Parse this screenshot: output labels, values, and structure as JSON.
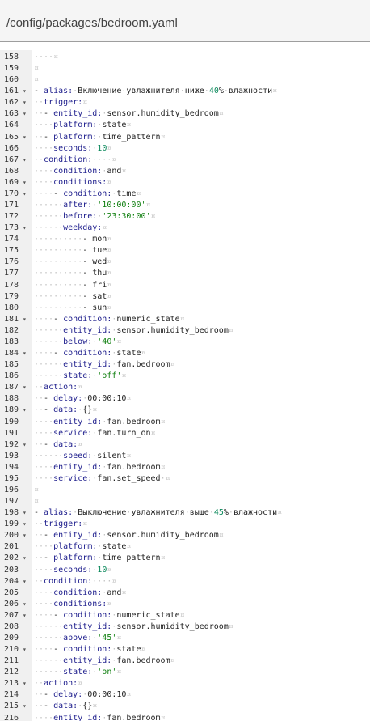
{
  "header": {
    "path": "/config/packages/bedroom.yaml"
  },
  "lines": [
    {
      "n": "158",
      "fold": "",
      "segs": [
        [
          "ws",
          "····¤"
        ]
      ]
    },
    {
      "n": "159",
      "fold": "",
      "segs": [
        [
          "ws",
          "¤"
        ]
      ]
    },
    {
      "n": "160",
      "fold": "",
      "segs": [
        [
          "ws",
          "¤"
        ]
      ]
    },
    {
      "n": "161",
      "fold": "▾",
      "segs": [
        [
          "p",
          "- "
        ],
        [
          "k",
          "alias:"
        ],
        [
          "ws",
          "·"
        ],
        [
          "p",
          "Включение"
        ],
        [
          "ws",
          "·"
        ],
        [
          "p",
          "увлажнителя"
        ],
        [
          "ws",
          "·"
        ],
        [
          "p",
          "ниже"
        ],
        [
          "ws",
          "·"
        ],
        [
          "n",
          "40"
        ],
        [
          "p",
          "%"
        ],
        [
          "ws",
          "·"
        ],
        [
          "p",
          "влажности"
        ],
        [
          "ws",
          "¤"
        ]
      ]
    },
    {
      "n": "162",
      "fold": "▾",
      "segs": [
        [
          "ws",
          "··"
        ],
        [
          "k",
          "trigger:"
        ],
        [
          "ws",
          "¤"
        ]
      ]
    },
    {
      "n": "163",
      "fold": "▾",
      "segs": [
        [
          "ws",
          "··"
        ],
        [
          "p",
          "- "
        ],
        [
          "k",
          "entity_id:"
        ],
        [
          "ws",
          "·"
        ],
        [
          "p",
          "sensor.humidity_bedroom"
        ],
        [
          "ws",
          "¤"
        ]
      ]
    },
    {
      "n": "164",
      "fold": "",
      "segs": [
        [
          "ws",
          "····"
        ],
        [
          "k",
          "platform:"
        ],
        [
          "ws",
          "·"
        ],
        [
          "p",
          "state"
        ],
        [
          "ws",
          "¤"
        ]
      ]
    },
    {
      "n": "165",
      "fold": "▾",
      "segs": [
        [
          "ws",
          "··"
        ],
        [
          "p",
          "- "
        ],
        [
          "k",
          "platform:"
        ],
        [
          "ws",
          "·"
        ],
        [
          "p",
          "time_pattern"
        ],
        [
          "ws",
          "¤"
        ]
      ]
    },
    {
      "n": "166",
      "fold": "",
      "segs": [
        [
          "ws",
          "····"
        ],
        [
          "k",
          "seconds:"
        ],
        [
          "ws",
          "·"
        ],
        [
          "n",
          "10"
        ],
        [
          "ws",
          "¤"
        ]
      ]
    },
    {
      "n": "167",
      "fold": "▾",
      "segs": [
        [
          "ws",
          "··"
        ],
        [
          "k",
          "condition:"
        ],
        [
          "ws",
          "····¤"
        ]
      ]
    },
    {
      "n": "168",
      "fold": "",
      "segs": [
        [
          "ws",
          "····"
        ],
        [
          "k",
          "condition:"
        ],
        [
          "ws",
          "·"
        ],
        [
          "p",
          "and"
        ],
        [
          "ws",
          "¤"
        ]
      ]
    },
    {
      "n": "169",
      "fold": "▾",
      "segs": [
        [
          "ws",
          "····"
        ],
        [
          "k",
          "conditions:"
        ],
        [
          "ws",
          "¤"
        ]
      ]
    },
    {
      "n": "170",
      "fold": "▾",
      "segs": [
        [
          "ws",
          "····"
        ],
        [
          "p",
          "- "
        ],
        [
          "k",
          "condition:"
        ],
        [
          "ws",
          "·"
        ],
        [
          "p",
          "time"
        ],
        [
          "ws",
          "¤"
        ]
      ]
    },
    {
      "n": "171",
      "fold": "",
      "segs": [
        [
          "ws",
          "······"
        ],
        [
          "k",
          "after:"
        ],
        [
          "ws",
          "·"
        ],
        [
          "s",
          "'10:00:00'"
        ],
        [
          "ws",
          "¤"
        ]
      ]
    },
    {
      "n": "172",
      "fold": "",
      "segs": [
        [
          "ws",
          "······"
        ],
        [
          "k",
          "before:"
        ],
        [
          "ws",
          "·"
        ],
        [
          "s",
          "'23:30:00'"
        ],
        [
          "ws",
          "¤"
        ]
      ]
    },
    {
      "n": "173",
      "fold": "▾",
      "segs": [
        [
          "ws",
          "······"
        ],
        [
          "k",
          "weekday:"
        ],
        [
          "ws",
          "¤"
        ]
      ]
    },
    {
      "n": "174",
      "fold": "",
      "segs": [
        [
          "ws",
          "··········"
        ],
        [
          "p",
          "- mon"
        ],
        [
          "ws",
          "¤"
        ]
      ]
    },
    {
      "n": "175",
      "fold": "",
      "segs": [
        [
          "ws",
          "··········"
        ],
        [
          "p",
          "- tue"
        ],
        [
          "ws",
          "¤"
        ]
      ]
    },
    {
      "n": "176",
      "fold": "",
      "segs": [
        [
          "ws",
          "··········"
        ],
        [
          "p",
          "- wed"
        ],
        [
          "ws",
          "¤"
        ]
      ]
    },
    {
      "n": "177",
      "fold": "",
      "segs": [
        [
          "ws",
          "··········"
        ],
        [
          "p",
          "- thu"
        ],
        [
          "ws",
          "¤"
        ]
      ]
    },
    {
      "n": "178",
      "fold": "",
      "segs": [
        [
          "ws",
          "··········"
        ],
        [
          "p",
          "- fri"
        ],
        [
          "ws",
          "¤"
        ]
      ]
    },
    {
      "n": "179",
      "fold": "",
      "segs": [
        [
          "ws",
          "··········"
        ],
        [
          "p",
          "- sat"
        ],
        [
          "ws",
          "¤"
        ]
      ]
    },
    {
      "n": "180",
      "fold": "",
      "segs": [
        [
          "ws",
          "··········"
        ],
        [
          "p",
          "- sun"
        ],
        [
          "ws",
          "¤"
        ]
      ]
    },
    {
      "n": "181",
      "fold": "▾",
      "segs": [
        [
          "ws",
          "····"
        ],
        [
          "p",
          "- "
        ],
        [
          "k",
          "condition:"
        ],
        [
          "ws",
          "·"
        ],
        [
          "p",
          "numeric_state"
        ],
        [
          "ws",
          "¤"
        ]
      ]
    },
    {
      "n": "182",
      "fold": "",
      "segs": [
        [
          "ws",
          "······"
        ],
        [
          "k",
          "entity_id:"
        ],
        [
          "ws",
          "·"
        ],
        [
          "p",
          "sensor.humidity_bedroom"
        ],
        [
          "ws",
          "¤"
        ]
      ]
    },
    {
      "n": "183",
      "fold": "",
      "segs": [
        [
          "ws",
          "······"
        ],
        [
          "k",
          "below:"
        ],
        [
          "ws",
          "·"
        ],
        [
          "s",
          "'40'"
        ],
        [
          "ws",
          "¤"
        ]
      ]
    },
    {
      "n": "184",
      "fold": "▾",
      "segs": [
        [
          "ws",
          "····"
        ],
        [
          "p",
          "- "
        ],
        [
          "k",
          "condition:"
        ],
        [
          "ws",
          "·"
        ],
        [
          "p",
          "state"
        ],
        [
          "ws",
          "¤"
        ]
      ]
    },
    {
      "n": "185",
      "fold": "",
      "segs": [
        [
          "ws",
          "······"
        ],
        [
          "k",
          "entity_id:"
        ],
        [
          "ws",
          "·"
        ],
        [
          "p",
          "fan.bedroom"
        ],
        [
          "ws",
          "¤"
        ]
      ]
    },
    {
      "n": "186",
      "fold": "",
      "segs": [
        [
          "ws",
          "······"
        ],
        [
          "k",
          "state:"
        ],
        [
          "ws",
          "·"
        ],
        [
          "s",
          "'off'"
        ],
        [
          "ws",
          "¤"
        ]
      ]
    },
    {
      "n": "187",
      "fold": "▾",
      "segs": [
        [
          "ws",
          "··"
        ],
        [
          "k",
          "action:"
        ],
        [
          "ws",
          "¤"
        ]
      ]
    },
    {
      "n": "188",
      "fold": "",
      "segs": [
        [
          "ws",
          "··"
        ],
        [
          "p",
          "- "
        ],
        [
          "k",
          "delay:"
        ],
        [
          "ws",
          "·"
        ],
        [
          "p",
          "00:00:10"
        ],
        [
          "ws",
          "¤"
        ]
      ]
    },
    {
      "n": "189",
      "fold": "▾",
      "segs": [
        [
          "ws",
          "··"
        ],
        [
          "p",
          "- "
        ],
        [
          "k",
          "data:"
        ],
        [
          "ws",
          "·"
        ],
        [
          "p",
          "{}"
        ],
        [
          "ws",
          "¤"
        ]
      ]
    },
    {
      "n": "190",
      "fold": "",
      "segs": [
        [
          "ws",
          "····"
        ],
        [
          "k",
          "entity_id:"
        ],
        [
          "ws",
          "·"
        ],
        [
          "p",
          "fan.bedroom"
        ],
        [
          "ws",
          "¤"
        ]
      ]
    },
    {
      "n": "191",
      "fold": "",
      "segs": [
        [
          "ws",
          "····"
        ],
        [
          "k",
          "service:"
        ],
        [
          "ws",
          "·"
        ],
        [
          "p",
          "fan.turn_on"
        ],
        [
          "ws",
          "¤"
        ]
      ]
    },
    {
      "n": "192",
      "fold": "▾",
      "segs": [
        [
          "ws",
          "··"
        ],
        [
          "p",
          "- "
        ],
        [
          "k",
          "data:"
        ],
        [
          "ws",
          "¤"
        ]
      ]
    },
    {
      "n": "193",
      "fold": "",
      "segs": [
        [
          "ws",
          "······"
        ],
        [
          "k",
          "speed:"
        ],
        [
          "ws",
          "·"
        ],
        [
          "p",
          "silent"
        ],
        [
          "ws",
          "¤"
        ]
      ]
    },
    {
      "n": "194",
      "fold": "",
      "segs": [
        [
          "ws",
          "····"
        ],
        [
          "k",
          "entity_id:"
        ],
        [
          "ws",
          "·"
        ],
        [
          "p",
          "fan.bedroom"
        ],
        [
          "ws",
          "¤"
        ]
      ]
    },
    {
      "n": "195",
      "fold": "",
      "segs": [
        [
          "ws",
          "····"
        ],
        [
          "k",
          "service:"
        ],
        [
          "ws",
          "·"
        ],
        [
          "p",
          "fan.set_speed"
        ],
        [
          "ws",
          "·¤"
        ]
      ]
    },
    {
      "n": "196",
      "fold": "",
      "segs": [
        [
          "ws",
          "¤"
        ]
      ]
    },
    {
      "n": "197",
      "fold": "",
      "segs": [
        [
          "ws",
          "¤"
        ]
      ]
    },
    {
      "n": "198",
      "fold": "▾",
      "segs": [
        [
          "p",
          "- "
        ],
        [
          "k",
          "alias:"
        ],
        [
          "ws",
          "·"
        ],
        [
          "p",
          "Выключение"
        ],
        [
          "ws",
          "·"
        ],
        [
          "p",
          "увлажнителя"
        ],
        [
          "ws",
          "·"
        ],
        [
          "p",
          "выше"
        ],
        [
          "ws",
          "·"
        ],
        [
          "n",
          "45"
        ],
        [
          "p",
          "%"
        ],
        [
          "ws",
          "·"
        ],
        [
          "p",
          "влажности"
        ],
        [
          "ws",
          "¤"
        ]
      ]
    },
    {
      "n": "199",
      "fold": "▾",
      "segs": [
        [
          "ws",
          "··"
        ],
        [
          "k",
          "trigger:"
        ],
        [
          "ws",
          "¤"
        ]
      ]
    },
    {
      "n": "200",
      "fold": "▾",
      "segs": [
        [
          "ws",
          "··"
        ],
        [
          "p",
          "- "
        ],
        [
          "k",
          "entity_id:"
        ],
        [
          "ws",
          "·"
        ],
        [
          "p",
          "sensor.humidity_bedroom"
        ],
        [
          "ws",
          "¤"
        ]
      ]
    },
    {
      "n": "201",
      "fold": "",
      "segs": [
        [
          "ws",
          "····"
        ],
        [
          "k",
          "platform:"
        ],
        [
          "ws",
          "·"
        ],
        [
          "p",
          "state"
        ],
        [
          "ws",
          "¤"
        ]
      ]
    },
    {
      "n": "202",
      "fold": "▾",
      "segs": [
        [
          "ws",
          "··"
        ],
        [
          "p",
          "- "
        ],
        [
          "k",
          "platform:"
        ],
        [
          "ws",
          "·"
        ],
        [
          "p",
          "time_pattern"
        ],
        [
          "ws",
          "¤"
        ]
      ]
    },
    {
      "n": "203",
      "fold": "",
      "segs": [
        [
          "ws",
          "····"
        ],
        [
          "k",
          "seconds:"
        ],
        [
          "ws",
          "·"
        ],
        [
          "n",
          "10"
        ],
        [
          "ws",
          "¤"
        ]
      ]
    },
    {
      "n": "204",
      "fold": "▾",
      "segs": [
        [
          "ws",
          "··"
        ],
        [
          "k",
          "condition:"
        ],
        [
          "ws",
          "····¤"
        ]
      ]
    },
    {
      "n": "205",
      "fold": "",
      "segs": [
        [
          "ws",
          "····"
        ],
        [
          "k",
          "condition:"
        ],
        [
          "ws",
          "·"
        ],
        [
          "p",
          "and"
        ],
        [
          "ws",
          "¤"
        ]
      ]
    },
    {
      "n": "206",
      "fold": "▾",
      "segs": [
        [
          "ws",
          "····"
        ],
        [
          "k",
          "conditions:"
        ],
        [
          "ws",
          "¤"
        ]
      ]
    },
    {
      "n": "207",
      "fold": "▾",
      "segs": [
        [
          "ws",
          "····"
        ],
        [
          "p",
          "- "
        ],
        [
          "k",
          "condition:"
        ],
        [
          "ws",
          "·"
        ],
        [
          "p",
          "numeric_state"
        ],
        [
          "ws",
          "¤"
        ]
      ]
    },
    {
      "n": "208",
      "fold": "",
      "segs": [
        [
          "ws",
          "······"
        ],
        [
          "k",
          "entity_id:"
        ],
        [
          "ws",
          "·"
        ],
        [
          "p",
          "sensor.humidity_bedroom"
        ],
        [
          "ws",
          "¤"
        ]
      ]
    },
    {
      "n": "209",
      "fold": "",
      "segs": [
        [
          "ws",
          "······"
        ],
        [
          "k",
          "above:"
        ],
        [
          "ws",
          "·"
        ],
        [
          "s",
          "'45'"
        ],
        [
          "ws",
          "¤"
        ]
      ]
    },
    {
      "n": "210",
      "fold": "▾",
      "segs": [
        [
          "ws",
          "····"
        ],
        [
          "p",
          "- "
        ],
        [
          "k",
          "condition:"
        ],
        [
          "ws",
          "·"
        ],
        [
          "p",
          "state"
        ],
        [
          "ws",
          "¤"
        ]
      ]
    },
    {
      "n": "211",
      "fold": "",
      "segs": [
        [
          "ws",
          "······"
        ],
        [
          "k",
          "entity_id:"
        ],
        [
          "ws",
          "·"
        ],
        [
          "p",
          "fan.bedroom"
        ],
        [
          "ws",
          "¤"
        ]
      ]
    },
    {
      "n": "212",
      "fold": "",
      "segs": [
        [
          "ws",
          "······"
        ],
        [
          "k",
          "state:"
        ],
        [
          "ws",
          "·"
        ],
        [
          "s",
          "'on'"
        ],
        [
          "ws",
          "¤"
        ]
      ]
    },
    {
      "n": "213",
      "fold": "▾",
      "segs": [
        [
          "ws",
          "··"
        ],
        [
          "k",
          "action:"
        ],
        [
          "ws",
          "¤"
        ]
      ]
    },
    {
      "n": "214",
      "fold": "",
      "segs": [
        [
          "ws",
          "··"
        ],
        [
          "p",
          "- "
        ],
        [
          "k",
          "delay:"
        ],
        [
          "ws",
          "·"
        ],
        [
          "p",
          "00:00:10"
        ],
        [
          "ws",
          "¤"
        ]
      ]
    },
    {
      "n": "215",
      "fold": "▾",
      "segs": [
        [
          "ws",
          "··"
        ],
        [
          "p",
          "- "
        ],
        [
          "k",
          "data:"
        ],
        [
          "ws",
          "·"
        ],
        [
          "p",
          "{}"
        ],
        [
          "ws",
          "¤"
        ]
      ]
    },
    {
      "n": "216",
      "fold": "",
      "segs": [
        [
          "ws",
          "····"
        ],
        [
          "k",
          "entity_id:"
        ],
        [
          "ws",
          "·"
        ],
        [
          "p",
          "fan.bedroom"
        ],
        [
          "ws",
          "¤"
        ]
      ]
    }
  ]
}
